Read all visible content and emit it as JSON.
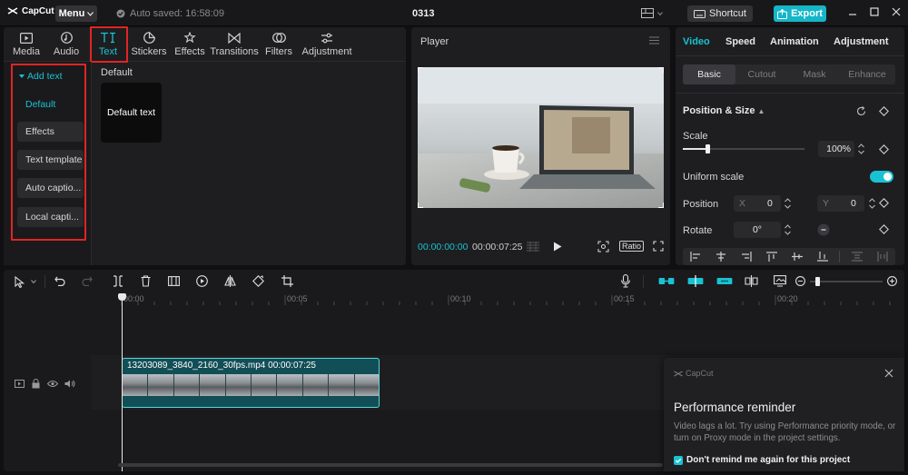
{
  "app": {
    "logo": "CapCut",
    "menu_label": "Menu",
    "autosave": "Auto saved: 16:58:09",
    "project_title": "0313",
    "shortcut_label": "Shortcut",
    "export_label": "Export",
    "accent": "#19c2d3"
  },
  "left_panel": {
    "tabs": [
      {
        "label": "Media",
        "icon": "media-icon"
      },
      {
        "label": "Audio",
        "icon": "audio-icon"
      },
      {
        "label": "Text",
        "icon": "text-icon"
      },
      {
        "label": "Stickers",
        "icon": "stickers-icon"
      },
      {
        "label": "Effects",
        "icon": "effects-icon"
      },
      {
        "label": "Transitions",
        "icon": "transitions-icon"
      },
      {
        "label": "Filters",
        "icon": "filters-icon"
      },
      {
        "label": "Adjustment",
        "icon": "adjustment-icon"
      }
    ],
    "active_tab": "Text",
    "nav_header": "Add text",
    "nav_items": [
      "Default",
      "Effects",
      "Text template",
      "Auto captio...",
      "Local capti..."
    ],
    "section_label": "Default",
    "card_label": "Default text"
  },
  "player": {
    "title": "Player",
    "timecode_current": "00:00:00:00",
    "timecode_total": "00:00:07:25",
    "ratio_label": "Ratio"
  },
  "right_panel": {
    "tabs": [
      "Video",
      "Speed",
      "Animation",
      "Adjustment"
    ],
    "active_tab": "Video",
    "subtabs": [
      "Basic",
      "Cutout",
      "Mask",
      "Enhance"
    ],
    "active_subtab": "Basic",
    "section_title": "Position & Size",
    "scale_label": "Scale",
    "scale_value": "100%",
    "scale_level": 0.2,
    "uniform_scale_label": "Uniform scale",
    "uniform_scale_on": true,
    "position_label": "Position",
    "pos_x_label": "X",
    "pos_x_value": "0",
    "pos_y_label": "Y",
    "pos_y_value": "0",
    "rotate_label": "Rotate",
    "rotate_value": "0°"
  },
  "timeline": {
    "ruler_labels": [
      "00:00",
      "00:05",
      "00:10",
      "00:15",
      "00:20"
    ],
    "clip_label": "13203089_3840_2160_30fps.mp4   00:00:07:25"
  },
  "toast": {
    "brand": "CapCut",
    "title": "Performance reminder",
    "body": "Video lags a lot. Try using Performance priority mode, or turn on Proxy mode in the project settings.",
    "checkbox_label": "Don't remind me again for this project",
    "checked": true
  }
}
